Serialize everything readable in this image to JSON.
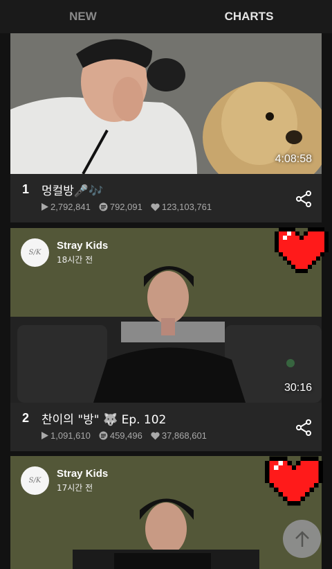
{
  "tabs": [
    {
      "label": "NEW"
    },
    {
      "label": "CHARTS"
    }
  ],
  "videos": [
    {
      "rank": "1",
      "title": "멍컬방🎤🎶",
      "duration": "4:08:58",
      "views": "2,792,841",
      "comments": "792,091",
      "likes": "123,103,761"
    },
    {
      "rank": "2",
      "title": "찬이의 \"방\" 🐺 Ep. 102",
      "duration": "30:16",
      "views": "1,091,610",
      "comments": "459,496",
      "likes": "37,868,601",
      "channel": "Stray Kids",
      "time": "18시간 전"
    },
    {
      "channel": "Stray Kids",
      "time": "17시간 전"
    }
  ],
  "colors": {
    "background": "#121212",
    "card": "#262626",
    "heart": "#ff1a1a"
  },
  "icons": {
    "scroll_top": "arrow-up-icon",
    "share": "share-icon",
    "heart": "pixel-heart-icon"
  }
}
